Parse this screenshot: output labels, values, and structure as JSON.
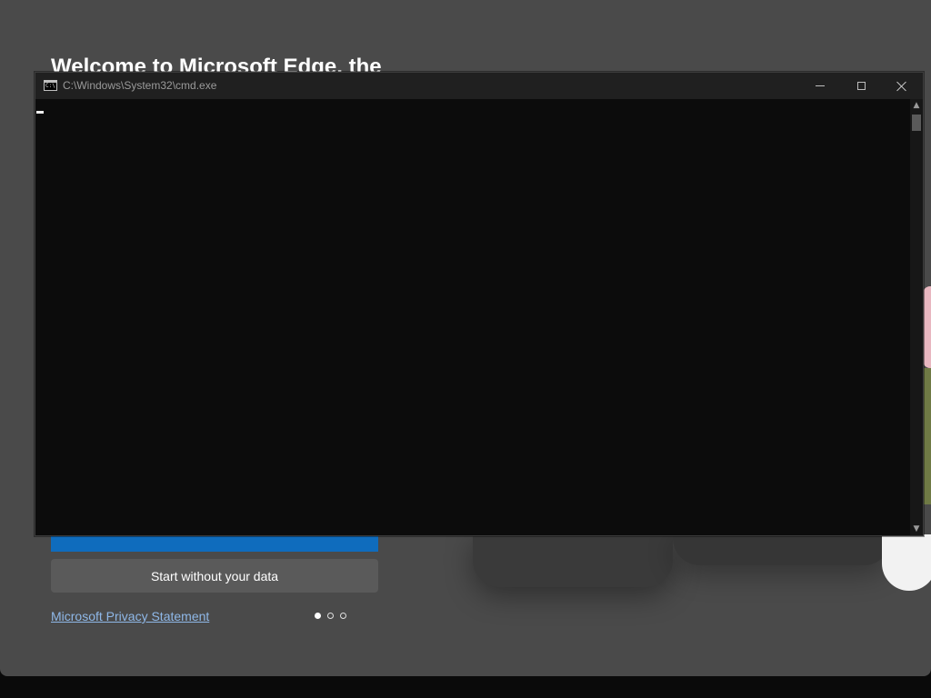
{
  "edge": {
    "welcome_title": "Welcome to Microsoft Edge, the",
    "start_without_data": "Start without your data",
    "privacy_link": "Microsoft Privacy Statement",
    "pager": {
      "total": 3,
      "active_index": 0
    },
    "accent_color": "#0f6cbd"
  },
  "cmd": {
    "title": "C:\\Windows\\System32\\cmd.exe",
    "icon": "cmd-icon",
    "controls": [
      "minimize-icon",
      "maximize-icon",
      "close-icon"
    ],
    "console_text": ""
  }
}
